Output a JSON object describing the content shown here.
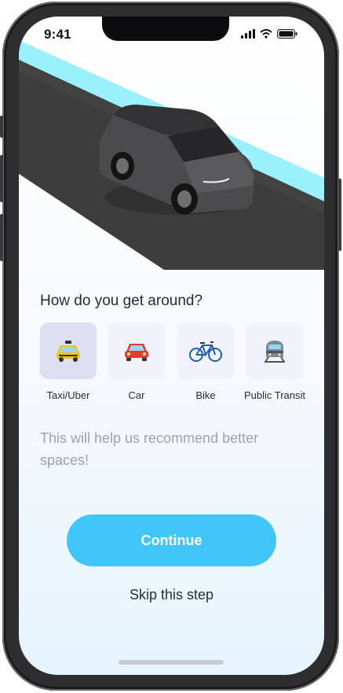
{
  "status_bar": {
    "time": "9:41"
  },
  "hero": {
    "image_icon": "car-on-road-illustration"
  },
  "question": "How do you get around?",
  "options": [
    {
      "label": "Taxi/Uber",
      "icon": "taxi-icon",
      "selected": true
    },
    {
      "label": "Car",
      "icon": "car-icon",
      "selected": false
    },
    {
      "label": "Bike",
      "icon": "bike-icon",
      "selected": false
    },
    {
      "label": "Public Transit",
      "icon": "train-icon",
      "selected": false
    }
  ],
  "helper_text": "This will help us recommend better spaces!",
  "continue_label": "Continue",
  "skip_label": "Skip this step",
  "colors": {
    "accent": "#41c6f7",
    "selected_option_bg": "#dedff0",
    "option_bg": "#f1f2fb"
  }
}
